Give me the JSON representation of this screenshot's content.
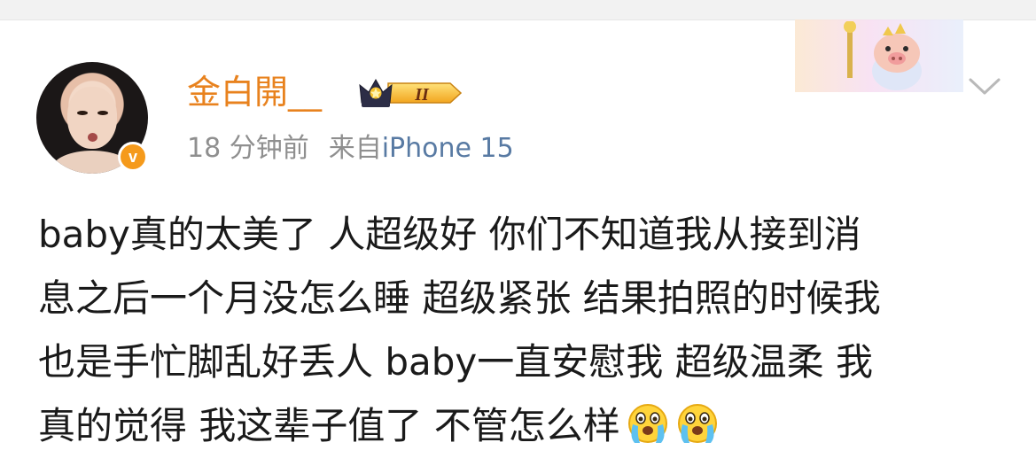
{
  "post": {
    "username": "金白開__",
    "level_badge": "II",
    "time": "18 分钟前",
    "source_prefix": "来自",
    "source_name": "iPhone 15",
    "verified_mark": "v",
    "body_lines": [
      "baby真的太美了 人超级好 你们不知道我从接到消",
      "息之后一个月没怎么睡 超级紧张 结果拍照的时候我",
      "也是手忙脚乱好丢人 baby一直安慰我 超级温柔 我",
      "真的觉得 我这辈子值了 不管怎么样"
    ],
    "emojis": [
      "crying-face-icon",
      "crying-face-icon"
    ]
  },
  "colors": {
    "username": "#e8821e",
    "meta": "#8f8f8f",
    "source": "#587aa3",
    "badge": "#f59a1b",
    "text": "#1a1a1a"
  }
}
